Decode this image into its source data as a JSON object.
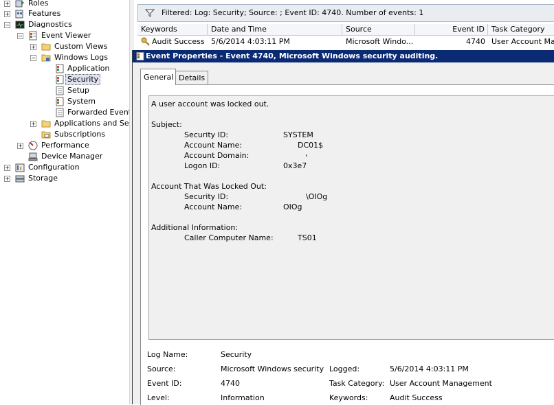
{
  "tree": {
    "roles": "Roles",
    "features": "Features",
    "diagnostics": "Diagnostics",
    "event_viewer": "Event Viewer",
    "custom_views": "Custom Views",
    "windows_logs": "Windows Logs",
    "application": "Application",
    "security": "Security",
    "setup": "Setup",
    "system": "System",
    "forwarded_events": "Forwarded Events",
    "apps_services": "Applications and Servic",
    "subscriptions": "Subscriptions",
    "performance": "Performance",
    "device_manager": "Device Manager",
    "configuration": "Configuration",
    "storage": "Storage"
  },
  "event_list": {
    "filter_text": "Filtered: Log: Security; Source: ; Event ID: 4740. Number of events: 1",
    "columns": [
      "Keywords",
      "Date and Time",
      "Source",
      "Event ID",
      "Task Category"
    ],
    "row": {
      "keywords": "Audit Success",
      "date_time": "5/6/2014 4:03:11 PM",
      "source": "Microsoft Windo...",
      "event_id": "4740",
      "task_category": "User Account Ma..."
    }
  },
  "dialog": {
    "title": "Event Properties - Event 4740, Microsoft Windows security auditing.",
    "tabs": [
      "General",
      "Details"
    ],
    "description": {
      "intro": "A user account was locked out.",
      "subject_header": "Subject:",
      "security_id_label": "Security ID:",
      "security_id_value": "SYSTEM",
      "account_name_label": "Account Name:",
      "account_name_value": "DC01$",
      "account_domain_label": "Account Domain:",
      "account_domain_value": ",",
      "logon_id_label": "Logon ID:",
      "logon_id_value": "0x3e7",
      "locked_header": "Account That Was Locked Out:",
      "locked_security_id_label": "Security ID:",
      "locked_security_id_value": "\\OIOg",
      "locked_account_name_label": "Account Name:",
      "locked_account_name_value": "OIOg",
      "additional_header": "Additional Information:",
      "caller_label": "Caller Computer Name:",
      "caller_value": "TS01"
    },
    "fields": {
      "log_name_label": "Log Name:",
      "log_name_value": "Security",
      "source_label": "Source:",
      "source_value": "Microsoft Windows security",
      "logged_label": "Logged:",
      "logged_value": "5/6/2014 4:03:11 PM",
      "event_id_label": "Event ID:",
      "event_id_value": "4740",
      "task_category_label": "Task Category:",
      "task_category_value": "User Account Management",
      "level_label": "Level:",
      "level_value": "Information",
      "keywords_label": "Keywords:",
      "keywords_value": "Audit Success"
    }
  },
  "colors": {
    "titlebar": "#0b2a74",
    "selected_item": "#dde4ee",
    "filter_bar": "#e9edf2"
  }
}
